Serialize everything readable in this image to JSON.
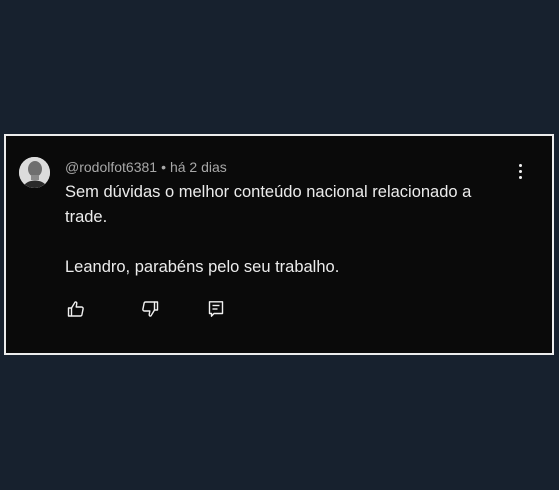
{
  "comment": {
    "author": "@rodolfot6381",
    "separator": "•",
    "time": "há 2 dias",
    "paragraphs": [
      "Sem dúvidas o melhor conteúdo nacional relacionado a trade.",
      "Leandro, parabéns pelo seu trabalho."
    ]
  },
  "actions": {
    "like_icon": "thumbs-up-icon",
    "dislike_icon": "thumbs-down-icon",
    "reply_icon": "reply-comment-icon",
    "more_icon": "vertical-ellipsis-icon"
  },
  "colors": {
    "page_background": "#17212e",
    "card_background": "#0a0a0a",
    "card_border": "#ececec",
    "text_primary": "#ececec",
    "text_secondary": "#a8a8a8"
  }
}
